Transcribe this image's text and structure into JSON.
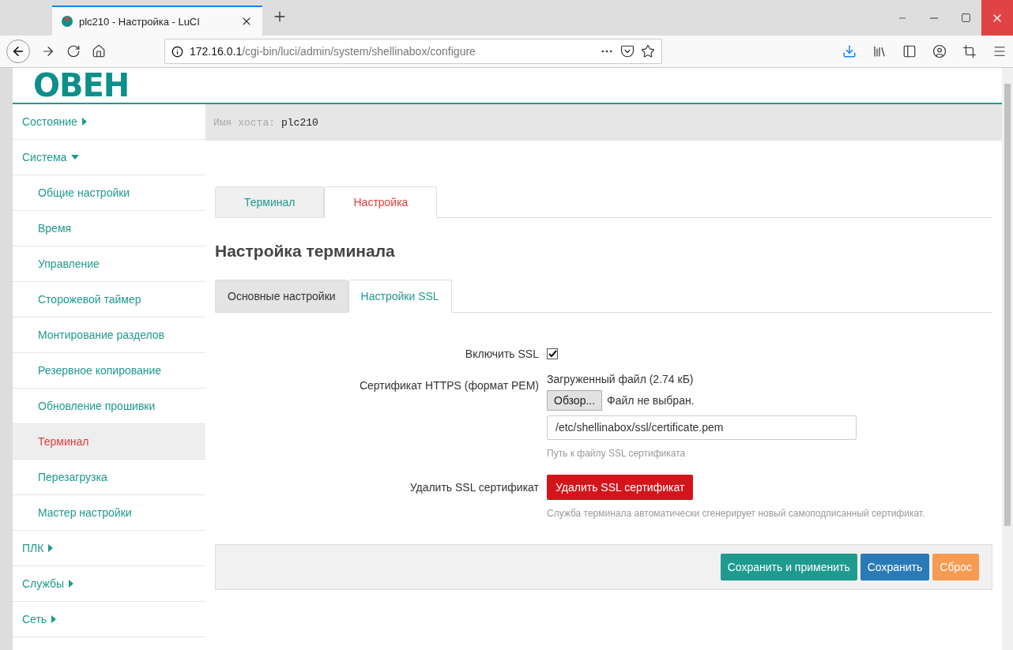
{
  "browser": {
    "tab_title": "plc210 - Настройка - LuCI",
    "url_host": "172.16.0.1",
    "url_path": "/cgi-bin/luci/admin/system/shellinabox/configure"
  },
  "logo": "ОВЕН",
  "sidebar": {
    "items": [
      {
        "label": "Состояние",
        "expanded": false
      },
      {
        "label": "Система",
        "expanded": true,
        "children": [
          {
            "label": "Общие настройки",
            "selected": false
          },
          {
            "label": "Время",
            "selected": false
          },
          {
            "label": "Управление",
            "selected": false
          },
          {
            "label": "Сторожевой таймер",
            "selected": false
          },
          {
            "label": "Монтирование разделов",
            "selected": false
          },
          {
            "label": "Резервное копирование",
            "selected": false
          },
          {
            "label": "Обновление прошивки",
            "selected": false
          },
          {
            "label": "Терминал",
            "selected": true
          },
          {
            "label": "Перезагрузка",
            "selected": false
          },
          {
            "label": "Мастер настройки",
            "selected": false
          }
        ]
      },
      {
        "label": "ПЛК",
        "expanded": false
      },
      {
        "label": "Службы",
        "expanded": false
      },
      {
        "label": "Сеть",
        "expanded": false
      }
    ]
  },
  "hostname": {
    "label": "Имя хоста:",
    "value": "plc210"
  },
  "tabs": [
    {
      "label": "Терминал",
      "selected": false
    },
    {
      "label": "Настройка",
      "selected": true
    }
  ],
  "heading": "Настройка терминала",
  "subtabs": [
    {
      "label": "Основные настройки",
      "selected": false
    },
    {
      "label": "Настройки SSL",
      "selected": true
    }
  ],
  "form": [
    {
      "kind": "checkbox",
      "label": "Включить SSL",
      "checked": true
    },
    {
      "kind": "file",
      "label": "Сертификат HTTPS (формат PEM)",
      "status": "Загруженный файл (2.74 кБ)",
      "browse": "Обзор...",
      "no_file": "Файл не выбран.",
      "value": "/etc/shellinabox/ssl/certificate.pem",
      "hint": "Путь к файлу SSL сертификата"
    },
    {
      "kind": "button",
      "label": "Удалить SSL сертификат",
      "button": "Удалить SSL сертификат",
      "hint": "Служба терминала автоматически сгенерирует новый самоподписанный сертификат."
    }
  ],
  "actions": [
    {
      "label": "Сохранить и применить",
      "color": "#1f9a8f"
    },
    {
      "label": "Сохранить",
      "color": "#2a7ab8"
    },
    {
      "label": "Сброс",
      "color": "#f79a52"
    }
  ]
}
